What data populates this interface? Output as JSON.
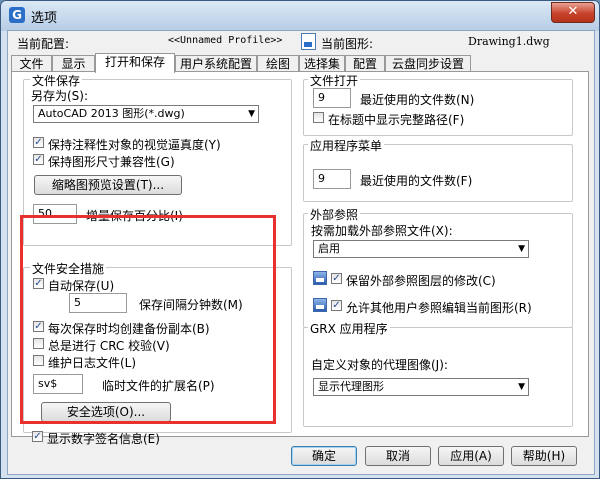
{
  "window": {
    "title": "选项",
    "close_glyph": "✕"
  },
  "profile": {
    "current_profile_label": "当前配置:",
    "current_profile_value": "<<Unnamed Profile>>",
    "current_drawing_label": "当前图形:",
    "current_drawing_value": "Drawing1.dwg"
  },
  "tabs": [
    {
      "label": "文件",
      "active": false
    },
    {
      "label": "显示",
      "active": false
    },
    {
      "label": "打开和保存",
      "active": true
    },
    {
      "label": "用户系统配置",
      "active": false
    },
    {
      "label": "绘图",
      "active": false
    },
    {
      "label": "选择集",
      "active": false
    },
    {
      "label": "配置",
      "active": false
    },
    {
      "label": "云盘同步设置",
      "active": false
    }
  ],
  "file_save": {
    "title": "文件保存",
    "save_as_label": "另存为(S):",
    "save_as_value": "AutoCAD 2013 图形(*.dwg)",
    "keep_annotative_label": "保持注释性对象的视觉逼真度(Y)",
    "keep_annotative_checked": true,
    "keep_size_compat_label": "保持图形尺寸兼容性(G)",
    "keep_size_compat_checked": true,
    "thumbnail_button": "缩略图预览设置(T)...",
    "incremental_value": "50",
    "incremental_label": "增量保存百分比(I)"
  },
  "safety": {
    "title": "文件安全措施",
    "autosave_label": "自动保存(U)",
    "autosave_checked": true,
    "minutes_value": "5",
    "minutes_label": "保存间隔分钟数(M)",
    "backup_label": "每次保存时均创建备份副本(B)",
    "backup_checked": true,
    "crc_label": "总是进行 CRC 校验(V)",
    "crc_checked": false,
    "log_label": "维护日志文件(L)",
    "log_checked": false,
    "temp_ext_value": "sv$",
    "temp_ext_label": "临时文件的扩展名(P)",
    "security_button": "安全选项(O)...",
    "digital_sig_label": "显示数字签名信息(E)",
    "digital_sig_checked": true
  },
  "file_open": {
    "title": "文件打开",
    "recent_value": "9",
    "recent_label": "最近使用的文件数(N)",
    "full_path_label": "在标题中显示完整路径(F)",
    "full_path_checked": false
  },
  "app_menu": {
    "title": "应用程序菜单",
    "recent_value": "9",
    "recent_label": "最近使用的文件数(F)"
  },
  "xref": {
    "title": "外部参照",
    "demand_load_label": "按需加载外部参照文件(X):",
    "demand_load_value": "启用",
    "retain_layer_label": "保留外部参照图层的修改(C)",
    "retain_layer_checked": true,
    "allow_edit_label": "允许其他用户参照编辑当前图形(R)",
    "allow_edit_checked": true
  },
  "grx": {
    "title": "GRX 应用程序",
    "proxy_label": "自定义对象的代理图像(J):",
    "proxy_value": "显示代理图形"
  },
  "buttons": {
    "ok": "确定",
    "cancel": "取消",
    "apply": "应用(A)",
    "help": "帮助(H)"
  },
  "icons": {
    "app": "gstarcad-logo-icon",
    "close": "close-icon",
    "drawing": "drawing-file-icon",
    "dropdown": "chevron-down-icon",
    "xref": "xref-icon"
  },
  "colors": {
    "highlight_box": "#e8302e"
  }
}
